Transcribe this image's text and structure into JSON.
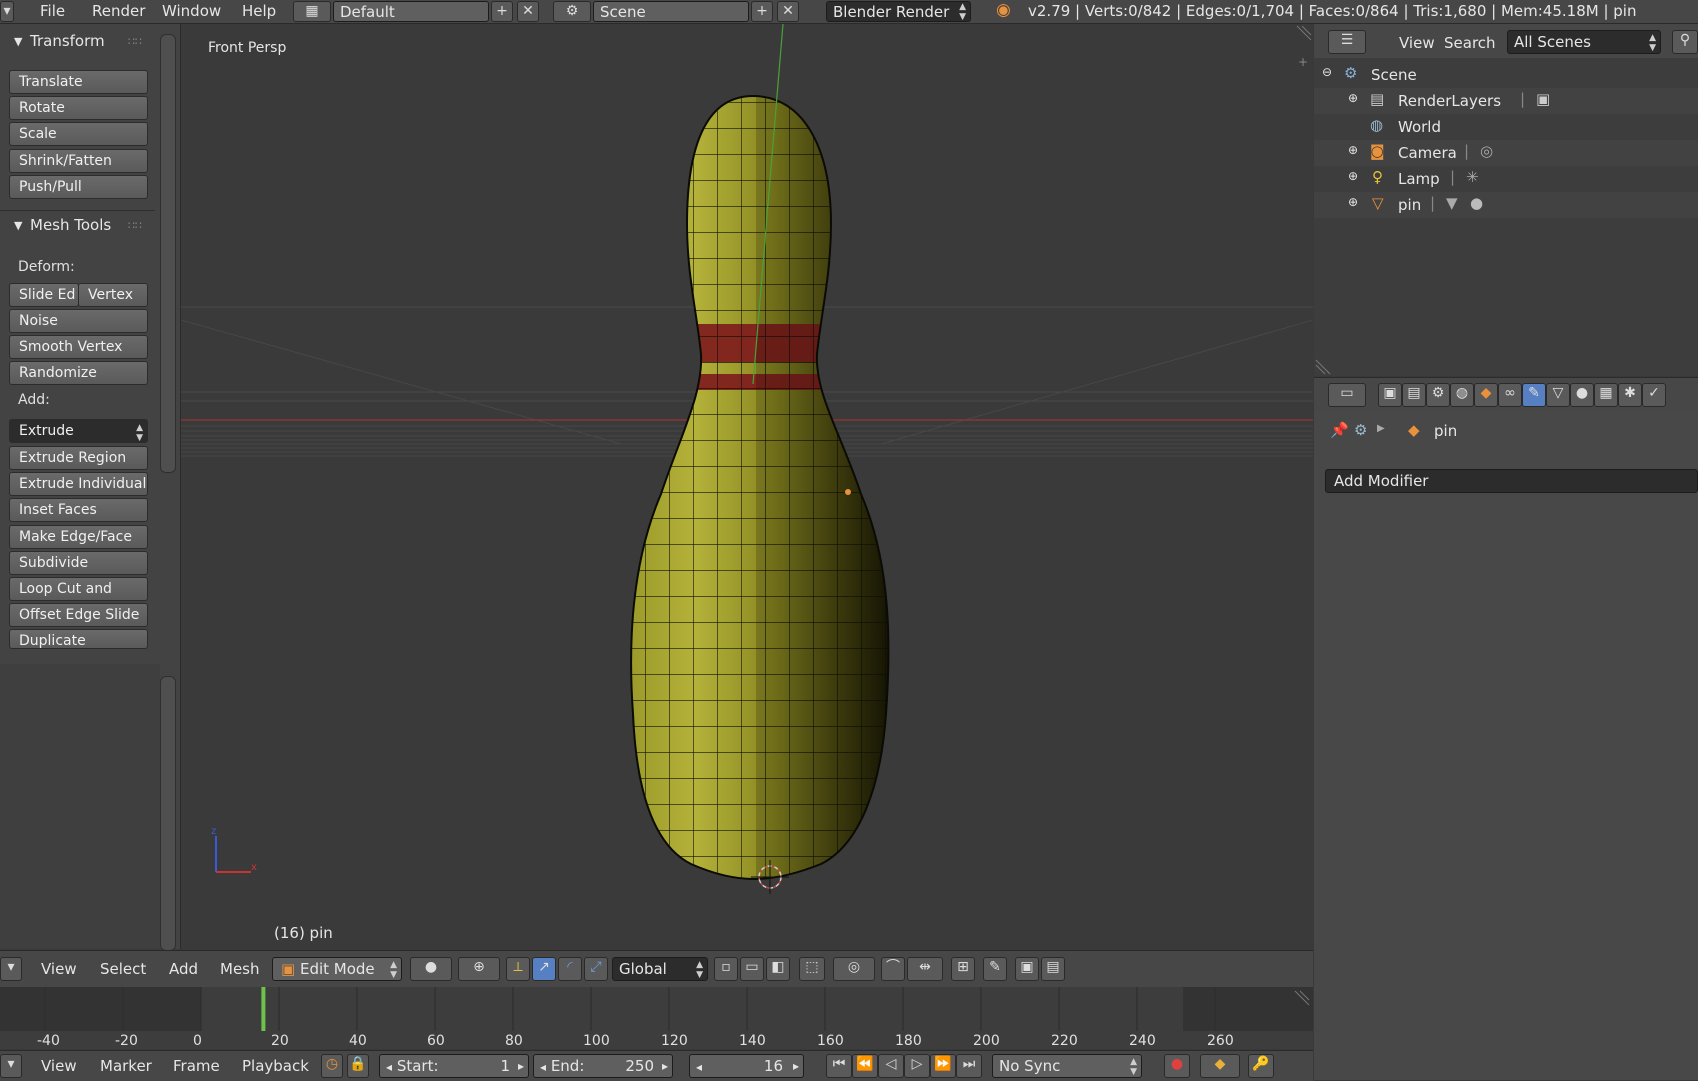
{
  "topbar": {
    "menus": [
      "File",
      "Render",
      "Window",
      "Help"
    ],
    "layout": "Default",
    "scene": "Scene",
    "engine": "Blender Render",
    "stats": "v2.79 | Verts:0/842 | Edges:0/1,704 | Faces:0/864 | Tris:1,680 | Mem:45.18M | pin"
  },
  "toolshelf": {
    "transform_title": "Transform",
    "transform_buttons": [
      "Translate",
      "Rotate",
      "Scale",
      "Shrink/Fatten",
      "Push/Pull"
    ],
    "mesh_tools_title": "Mesh Tools",
    "deform_label": "Deform:",
    "slide_edge": "Slide Ed",
    "vertex": "Vertex",
    "deform_buttons": [
      "Noise",
      "Smooth Vertex",
      "Randomize"
    ],
    "add_label": "Add:",
    "extrude": "Extrude",
    "add_buttons": [
      "Extrude Region",
      "Extrude Individual",
      "Inset Faces",
      "Make Edge/Face",
      "Subdivide",
      "Loop Cut and Slide",
      "Offset Edge Slide",
      "Duplicate"
    ]
  },
  "viewport": {
    "view_label": "Front Persp",
    "object_label": "(16) pin",
    "colors": {
      "mesh": "#8c8a22",
      "band": "#8b1f22",
      "x_axis": "#b03030",
      "y_axis": "#4aa13a"
    }
  },
  "outliner": {
    "view": "View",
    "search": "Search",
    "scope": "All Scenes",
    "items": [
      "Scene",
      "RenderLayers",
      "World",
      "Camera",
      "Lamp",
      "pin"
    ]
  },
  "properties": {
    "object_name": "pin",
    "add_modifier": "Add Modifier"
  },
  "view3d_header": {
    "menus": [
      "View",
      "Select",
      "Add",
      "Mesh"
    ],
    "mode": "Edit Mode",
    "orientation": "Global"
  },
  "timeline": {
    "ticks": [
      "-40",
      "-20",
      "0",
      "20",
      "40",
      "60",
      "80",
      "100",
      "120",
      "140",
      "160",
      "180",
      "200",
      "220",
      "240",
      "260"
    ],
    "tick_values": [
      -40,
      -20,
      0,
      20,
      40,
      60,
      80,
      100,
      120,
      140,
      160,
      180,
      200,
      220,
      240,
      260
    ],
    "current_frame_value": 16,
    "menus": [
      "View",
      "Marker",
      "Frame",
      "Playback"
    ],
    "start_label": "Start:",
    "start_value": "1",
    "end_label": "End:",
    "end_value": "250",
    "current_frame": "16",
    "sync": "No Sync"
  }
}
